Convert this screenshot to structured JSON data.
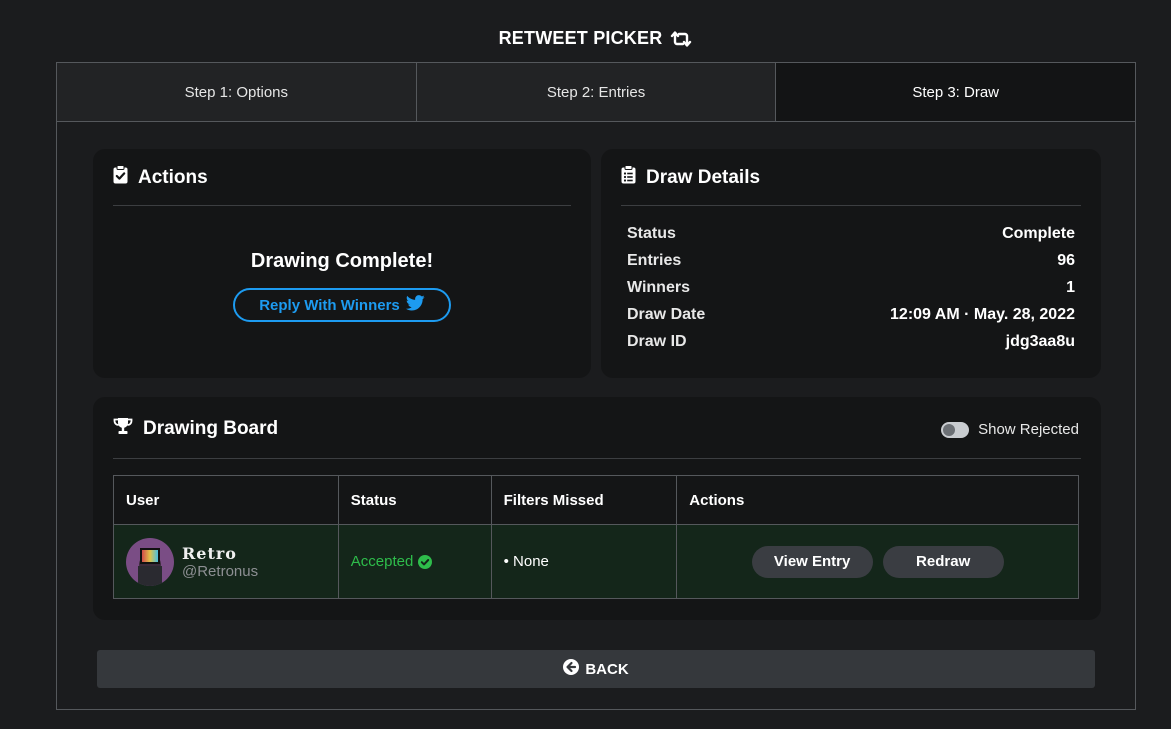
{
  "header": {
    "title": "RETWEET PICKER"
  },
  "tabs": [
    {
      "label": "Step 1: Options"
    },
    {
      "label": "Step 2: Entries"
    },
    {
      "label": "Step 3: Draw",
      "active": true
    }
  ],
  "actions_card": {
    "title": "Actions",
    "status_message": "Drawing Complete!",
    "reply_button": "Reply With Winners"
  },
  "details_card": {
    "title": "Draw Details",
    "rows": [
      {
        "label": "Status",
        "value": "Complete"
      },
      {
        "label": "Entries",
        "value": "96"
      },
      {
        "label": "Winners",
        "value": "1"
      },
      {
        "label": "Draw Date",
        "value": "12:09 AM · May. 28, 2022"
      },
      {
        "label": "Draw ID",
        "value": "jdg3aa8u"
      }
    ]
  },
  "board_card": {
    "title": "Drawing Board",
    "toggle_label": "Show Rejected",
    "toggle_on": false,
    "columns": [
      "User",
      "Status",
      "Filters Missed",
      "Actions"
    ],
    "rows": [
      {
        "name": "Retro",
        "handle": "@Retronus",
        "status": "Accepted",
        "filters_missed": "• None",
        "view_button": "View Entry",
        "redraw_button": "Redraw"
      }
    ]
  },
  "back_button": "BACK",
  "colors": {
    "background": "#1b1c1e",
    "card": "#141516",
    "accent_twitter": "#1d9bf0",
    "accepted_green": "#2ebd4b",
    "row_highlight": "#14261a"
  }
}
